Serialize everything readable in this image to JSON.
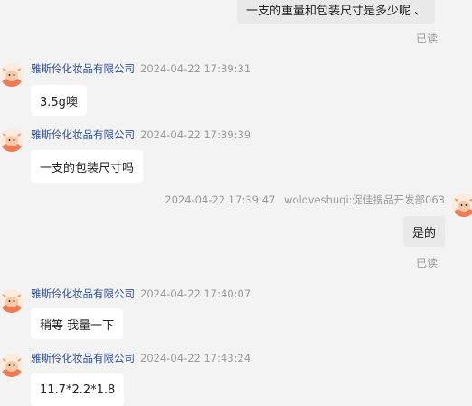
{
  "shop_name": "雅斯伶化妆品有限公司",
  "agent_name": "woloveshuqi:促佳搜品开发部063",
  "read_label": "已读",
  "messages": [
    {
      "side": "right",
      "text": "一支的重量和包装尺寸是多少呢 、"
    },
    {
      "side": "left",
      "time": "2024-04-22 17:39:31",
      "text": "3.5g噢"
    },
    {
      "side": "left",
      "time": "2024-04-22 17:39:39",
      "text": "一支的包装尺寸吗"
    },
    {
      "side": "right",
      "time": "2024-04-22 17:39:47",
      "text": "是的"
    },
    {
      "side": "left",
      "time": "2024-04-22 17:40:07",
      "text": "稍等 我量一下"
    },
    {
      "side": "left",
      "time": "2024-04-22 17:43:24",
      "text": "11.7*2.2*1.8"
    }
  ],
  "avatar_icon": "cow-cartoon-icon"
}
